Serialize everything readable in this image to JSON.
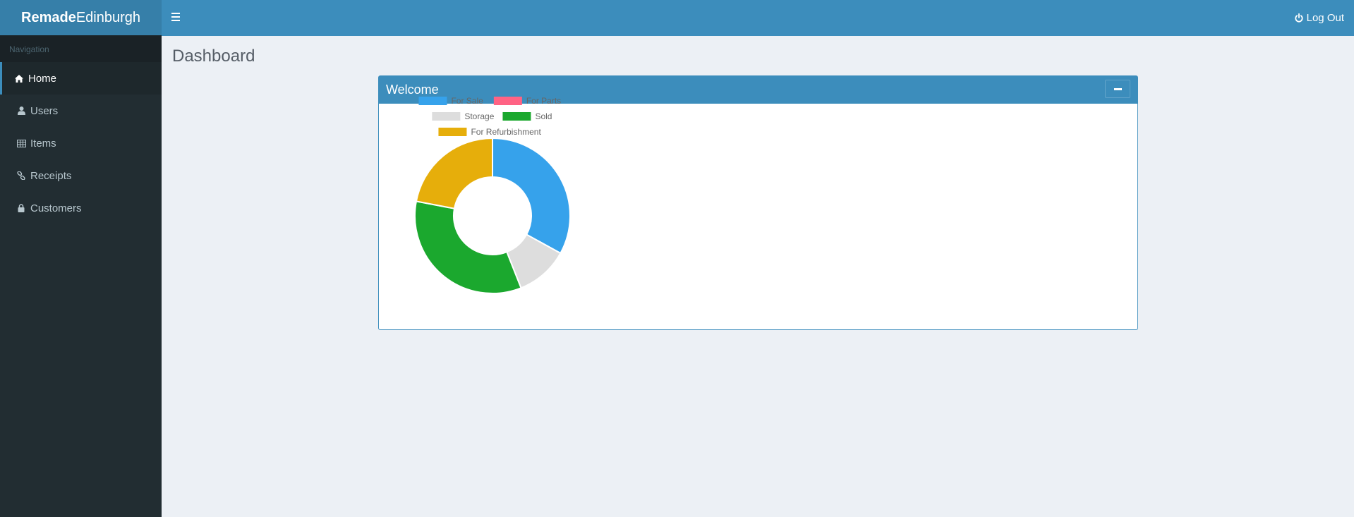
{
  "app": {
    "logo_bold": "Remade",
    "logo_light": "Edinburgh"
  },
  "sidebar": {
    "header": "Navigation",
    "items": [
      {
        "label": "Home",
        "icon": "home-icon",
        "active": true
      },
      {
        "label": "Users",
        "icon": "user-icon",
        "active": false
      },
      {
        "label": "Items",
        "icon": "table-icon",
        "active": false
      },
      {
        "label": "Receipts",
        "icon": "link-icon",
        "active": false
      },
      {
        "label": "Customers",
        "icon": "lock-icon",
        "active": false
      }
    ]
  },
  "topbar": {
    "logout_label": "Log Out"
  },
  "page": {
    "title": "Dashboard"
  },
  "box": {
    "title": "Welcome"
  },
  "chart_data": {
    "type": "pie",
    "donut": true,
    "legend_position": "top",
    "categories": [
      "For Sale",
      "For Parts",
      "Storage",
      "Sold",
      "For Refurbishment"
    ],
    "values": [
      33,
      0,
      11,
      34,
      22
    ],
    "colors": [
      "#36a2eb",
      "#ff6384",
      "#dddddd",
      "#1ba82e",
      "#e6ae0b"
    ]
  },
  "colors": {
    "primary": "#3c8dbc",
    "sidebar_bg": "#222d32",
    "content_bg": "#ecf0f5"
  }
}
